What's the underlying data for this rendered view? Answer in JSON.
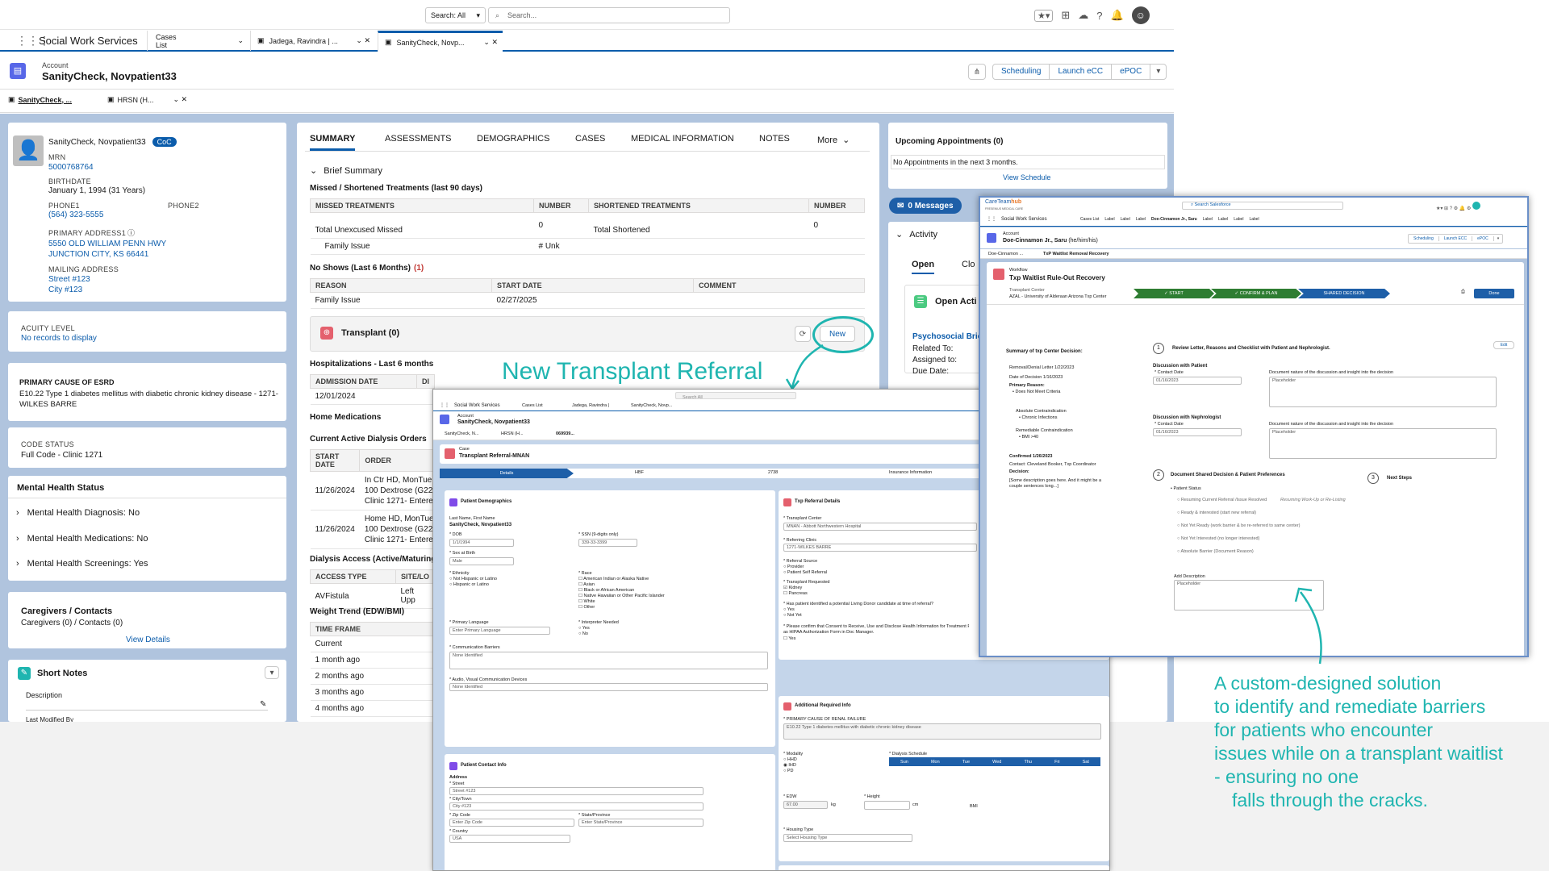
{
  "app": {
    "search_scope": "Search: All",
    "search_placeholder": "Search...",
    "name": "Social Work Services",
    "tabs": [
      {
        "label": "Cases List"
      },
      {
        "label": "Jadega, Ravindra | ..."
      },
      {
        "label": "SanityCheck, Novp..."
      }
    ]
  },
  "account": {
    "label": "Account",
    "name": "SanityCheck, Novpatient33",
    "actions": [
      "Scheduling",
      "Launch eCC",
      "ePOC"
    ]
  },
  "subtabs": [
    "SanityCheck, ...",
    "HRSN (H..."
  ],
  "patient": {
    "name": "SanityCheck, Novpatient33",
    "badge": "CoC",
    "mrn_label": "MRN",
    "mrn": "5000768764",
    "birthdate_label": "BIRTHDATE",
    "birthdate": "January 1, 1994 (31 Years)",
    "phone1_label": "PHONE1",
    "phone1": "(564) 323-5555",
    "phone2_label": "PHONE2",
    "address_label": "PRIMARY ADDRESS1",
    "address1": "5550 OLD WILLIAM PENN HWY",
    "address2": "JUNCTION CITY, KS 66441",
    "mailing_label": "MAILING ADDRESS",
    "mailing1": "Street #123",
    "mailing2": "City #123"
  },
  "acuity": {
    "label": "ACUITY LEVEL",
    "value": "No records to display"
  },
  "esrd": {
    "label": "PRIMARY CAUSE OF ESRD",
    "value": "E10.22 Type 1 diabetes mellitus with diabetic chronic kidney disease - 1271-WILKES BARRE"
  },
  "code_status": {
    "label": "CODE STATUS",
    "value": "Full Code - Clinic 1271"
  },
  "mental_health": {
    "title": "Mental Health Status",
    "items": [
      "Mental Health Diagnosis: No",
      "Mental Health Medications: No",
      "Mental Health Screenings: Yes"
    ]
  },
  "caregivers": {
    "title": "Caregivers / Contacts",
    "sub": "Caregivers (0) / Contacts (0)",
    "link": "View Details"
  },
  "short_notes": {
    "title": "Short Notes",
    "desc": "Description",
    "last": "Last Modified By"
  },
  "main_tabs": [
    "SUMMARY",
    "ASSESSMENTS",
    "DEMOGRAPHICS",
    "CASES",
    "MEDICAL INFORMATION",
    "NOTES",
    "More"
  ],
  "summary": {
    "brief": "Brief Summary",
    "missed_title": "Missed / Shortened Treatments (last 90 days)",
    "missed_headers": [
      "MISSED TREATMENTS",
      "NUMBER",
      "SHORTENED TREATMENTS",
      "NUMBER"
    ],
    "missed_row1": [
      "Total Unexcused Missed",
      "0",
      "Total Shortened",
      "0"
    ],
    "missed_row2": [
      "Family Issue",
      "# Unk"
    ],
    "noshow_title": "No Shows (Last 6 Months)",
    "noshow_count": "(1)",
    "noshow_headers": [
      "REASON",
      "START DATE",
      "COMMENT"
    ],
    "noshow_row": [
      "Family Issue",
      "02/27/2025"
    ],
    "transplant": "Transplant (0)",
    "new_btn": "New",
    "hosp_title": "Hospitalizations - Last 6 months",
    "hosp_header": "ADMISSION DATE",
    "hosp_header2": "DI",
    "hosp_row": "12/01/2024",
    "home_meds": "Home Medications",
    "dialysis_orders": "Current Active Dialysis Orders",
    "orders_headers": [
      "START DATE",
      "ORDER"
    ],
    "orders": [
      {
        "date": "11/26/2024",
        "lines": [
          "In Ctr HD, MonTue",
          "100 Dextrose (G22",
          "Clinic 1271- Entere"
        ]
      },
      {
        "date": "11/26/2024",
        "lines": [
          "Home HD, MonTue",
          "100 Dextrose (G22",
          "Clinic 1271- Entere"
        ]
      }
    ],
    "access_title": "Dialysis Access (Active/Maturing",
    "access_headers": [
      "ACCESS TYPE",
      "SITE/LO"
    ],
    "access_row": [
      "AVFistula",
      "Left Upp"
    ],
    "weight_title": "Weight Trend (EDW/BMI)",
    "weight_header": "TIME FRAME",
    "weight_rows": [
      "Current",
      "1 month ago",
      "2 months ago",
      "3 months ago",
      "4 months ago"
    ]
  },
  "appointments": {
    "title": "Upcoming Appointments (0)",
    "none": "No Appointments in the next 3 months.",
    "link": "View Schedule"
  },
  "messages": "0 Messages",
  "activity": {
    "title": "Activity",
    "open": "Open",
    "closed": "Clo",
    "open_activities": "Open Acti",
    "item": "Psychosocial Brie",
    "related": "Related To:",
    "assigned": "Assigned to:",
    "due": "Due Date:"
  },
  "annotation1": "New Transplant Referral",
  "annotation2": [
    "A custom-designed solution",
    "to identify and remediate barriers",
    "for patients who encounter",
    "issues while on a transplant waitlist",
    "- ensuring no one",
    "falls through the cracks."
  ],
  "referral": {
    "app": "Social Work Services",
    "tabs": [
      "Cases List",
      "Jadega, Ravindra |",
      "SanityCheck, Novp..."
    ],
    "search": "Search All",
    "acc_label": "Account",
    "acc_name": "SanityCheck, Novpatient33",
    "subtabs": [
      "SanityCheck, N...",
      "HRSN (H...",
      "069939..."
    ],
    "case_label": "Case",
    "case_title": "Transplant Referral-MNAN",
    "steps": [
      "Details",
      "HBF",
      "2738",
      "Insurance Information"
    ],
    "demo_title": "Patient Demographics",
    "name_label": "Last Name, First Name",
    "name": "SanityCheck, Novpatient33",
    "dob_label": "* DOB",
    "dob": "1/1/1994",
    "ssn_label": "* SSN (9-digits only)",
    "ssn": "339-33-3399",
    "sex_label": "* Sex at Birth",
    "sex": "Male",
    "eth_label": "* Ethnicity",
    "eth": [
      "Not Hispanic or Latino",
      "Hispanic or Latino"
    ],
    "race_label": "* Race",
    "race": [
      "American Indian or Alaska Native",
      "Asian",
      "Black or African American",
      "Native Hawaiian or Other Pacific Islander",
      "White",
      "Other"
    ],
    "lang_label": "* Primary Language",
    "lang_ph": "Enter Primary Language",
    "interp_label": "* Interpreter Needed",
    "interp": [
      "Yes",
      "No"
    ],
    "comm_label": "* Communication Barriers",
    "comm": "None Identified",
    "av_label": "* Audio, Visual Communication Devices",
    "av": "None Identified",
    "contact_title": "Patient Contact Info",
    "address": "Address",
    "street_label": "* Street",
    "street": "Street #123",
    "city_label": "* City/Town",
    "city": "City #123",
    "zip_label": "* Zip Code",
    "zip_ph": "Enter Zip Code",
    "state_label": "* State/Province",
    "state_ph": "Enter State/Province",
    "country_label": "* Country",
    "country": "USA",
    "txp_title": "Txp Referral Details",
    "center_label": "* Transplant Center",
    "center": "MNAN - Abbott Northwestern Hospital",
    "clinic_label": "* Referring Clinic",
    "clinic": "1271-WILKES BARRE",
    "source_label": "* Referral Source",
    "source": [
      "Provider",
      "Patient Self Referral"
    ],
    "req_label": "* Transplant Requested",
    "req": [
      "Kidney",
      "Pancreas"
    ],
    "donor_q": "* Has patient identified a potential Living Donor candidate at time of referral?",
    "donor": [
      "Yes",
      "Not Yet"
    ],
    "consent_q": "* Please confirm that Consent to Receive, Use and Disclose Health Information for Treatment Pur",
    "consent_q2": "as HIPAA Authorization Form in Doc Manager.",
    "consent": [
      "Yes"
    ],
    "add_title": "Additional Required Info",
    "cause_label": "* PRIMARY CAUSE OF RENAL FAILURE",
    "cause": "E10.22 Type 1 diabetes mellitus with diabetic chronic kidney disease",
    "modality_label": "* Modality",
    "modality": [
      "HHD",
      "IHD",
      "PD"
    ],
    "sched_label": "* Dialysis Schedule",
    "days": [
      "Sun",
      "Mon",
      "Tue",
      "Wed",
      "Thu",
      "Fri",
      "Sat"
    ],
    "edw_label": "* EDW",
    "edw": "67.00",
    "kg": "kg",
    "height_label": "* Height",
    "cm": "cm",
    "bmi": "BMI",
    "housing_label": "* Housing Type",
    "housing_ph": "Select Housing Type"
  },
  "workflow": {
    "brand1": "CareTeam",
    "brand2": "hub",
    "brand_sub": "FRESENIUS MEDICAL CARE",
    "search": "Search Salesforce",
    "app": "Social Work Services",
    "tabs": [
      "Cases List",
      "Label",
      "Label",
      "Label",
      "Doe-Cinnamon Jr., Saru",
      "Label",
      "Label",
      "Label",
      "Label"
    ],
    "acc_label": "Account",
    "acc_name": "Doe-Cinnamon Jr., Saru",
    "pronoun": "(he/him/his)",
    "actions": [
      "Scheduling",
      "Launch ECC",
      "ePOC"
    ],
    "subtabs": [
      "Doe-Cinnamon ...",
      "TxP Waitlist Removal Recovery"
    ],
    "wf_label": "Workflow",
    "wf_title": "Txp  Waitlist Rule-Out Recovery",
    "center_label": "Transplant Center",
    "center": "AZAL - University of Alderaan Arizona Txp Center",
    "steps": [
      "START",
      "CONFIRM & PLAN",
      "SHARED DECISION"
    ],
    "done": "Done",
    "edit": "Edit",
    "summary_title": "Summary of txp Center Decision:",
    "removal": "Removal/Denial Letter  1/22/2023",
    "decision_date": "Date of Decision  1/16/2023",
    "reason_label": "Primary Reason:",
    "reason": "Does Not Meet Criteria",
    "abs_label": "Absolute Contraindication",
    "abs": "Chronic Infections",
    "rem_label": "Remediable Contraindication",
    "rem": "BMI >40",
    "confirmed": "Confirmed  1/26/2023",
    "contact": "Contact: Cleveland Booker, Txp Coordinator",
    "decision": "Decision:",
    "desc": "[Some description goes here. And it might be a couple sentences long...]",
    "step1": "Review Letter, Reasons and Checklist with Patient and Nephrologist.",
    "disc_patient": "Discussion with Patient",
    "disc_neph": "Discussion with Nephrologist",
    "contact_date": "* Contact Date",
    "date": "01/16/2023",
    "doc_label": "Document nature of the discussion and insight into the decision",
    "placeholder": "Placeholder",
    "step2": "Document Shared Decision & Patient Preferences",
    "step3": "Next Steps",
    "status_label": "Patient Status",
    "statuses": [
      "Resuming Current Referral /Issue Resolved",
      "Ready & interested (start new referral)",
      "Not Yet Ready (work barrier & be re-referred to same center)",
      "Not Yet Interested (no longer interested)",
      "Absolute Barrier (Document Reason)"
    ],
    "resuming_note": "Resuming Work-Up or Re-Listing",
    "add_desc": "Add Description"
  },
  "colors": {
    "brand_blue": "#0b5cab",
    "teal": "#1fb5b0",
    "page_bg": "#b0c4de",
    "wf_step": "#2e7d32",
    "wf_step_active": "#1e5fa8"
  }
}
